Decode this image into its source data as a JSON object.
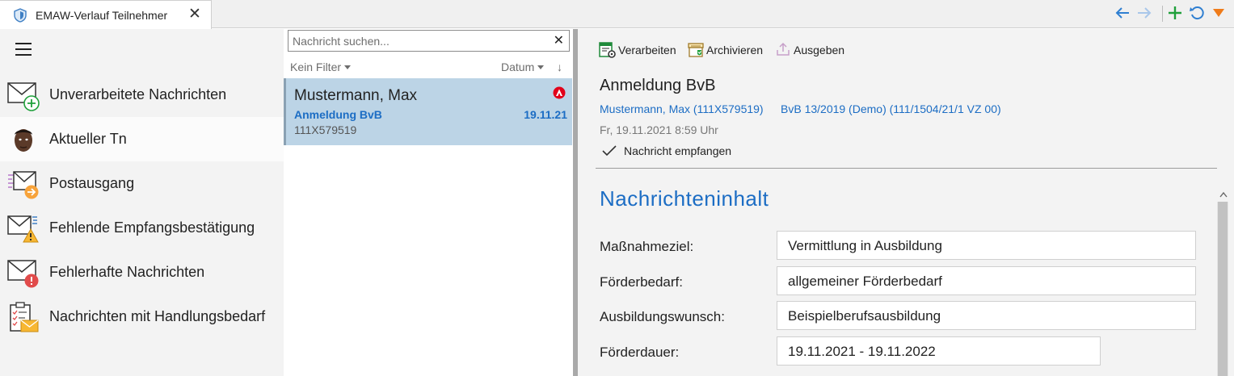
{
  "tab": {
    "title": "EMAW-Verlauf Teilnehmer",
    "close": "✕",
    "icon": "shield-icon"
  },
  "toolbar_right": {
    "back_icon": "arrow-left-icon",
    "forward_icon": "arrow-right-icon",
    "add_icon": "plus-icon",
    "refresh_icon": "refresh-icon",
    "menu_icon": "triangle-down-icon",
    "colors": {
      "nav": "#2f7fd1",
      "nav_disabled": "#a9c7ea",
      "add": "#1fa03b",
      "menu": "#ef7b1a"
    }
  },
  "nav": {
    "menu_icon": "hamburger-icon",
    "items": [
      {
        "label": "Unverarbeitete Nachrichten",
        "icon": "envelope-plus-icon",
        "active": false
      },
      {
        "label": "Aktueller Tn",
        "icon": "avatar",
        "active": true
      },
      {
        "label": "Postausgang",
        "icon": "envelope-outbox-icon",
        "active": false
      },
      {
        "label": "Fehlende Empfangsbestätigung",
        "icon": "envelope-warning-icon",
        "active": false
      },
      {
        "label": "Fehlerhafte Nachrichten",
        "icon": "envelope-error-icon",
        "active": false
      },
      {
        "label": "Nachrichten mit Handlungsbedarf",
        "icon": "clipboard-envelope-icon",
        "active": false
      }
    ]
  },
  "list": {
    "search_placeholder": "Nachricht suchen...",
    "search_clear": "✕",
    "filter": "Kein Filter",
    "sort": "Datum",
    "sort_direction": "↓",
    "messages": [
      {
        "name": "Mustermann, Max",
        "subject": "Anmeldung BvB",
        "date": "19.11.21",
        "id": "111X579519",
        "badge_icon": "agency-logo-icon"
      }
    ]
  },
  "detail": {
    "actions": {
      "process": "Verarbeiten",
      "archive": "Archivieren",
      "export": "Ausgeben"
    },
    "title": "Anmeldung BvB",
    "participant": "Mustermann, Max (111X579519)",
    "measure": "BvB 13/2019 (Demo) (111/1504/21/1 VZ 00)",
    "timestamp": "Fr, 19.11.2021 8:59 Uhr",
    "status": "Nachricht empfangen",
    "section_heading": "Nachrichteninhalt",
    "fields": [
      {
        "label": "Maßnahmeziel:",
        "value": "Vermittlung in Ausbildung"
      },
      {
        "label": "Förderbedarf:",
        "value": "allgemeiner Förderbedarf"
      },
      {
        "label": "Ausbildungswunsch:",
        "value": "Beispielberufsausbildung"
      },
      {
        "label": "Förderdauer:",
        "value": "19.11.2021 - 19.11.2022"
      }
    ]
  }
}
